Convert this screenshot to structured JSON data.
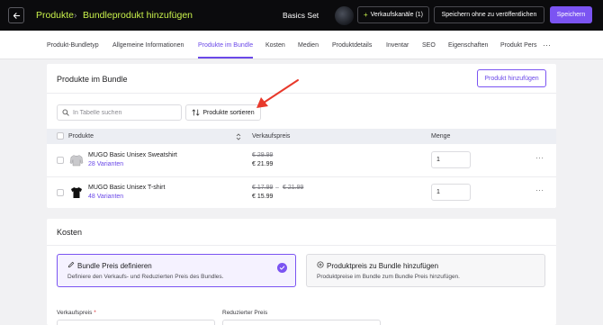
{
  "header": {
    "breadcrumb_root": "Produkte",
    "breadcrumb_current": "Bundleprodukt hinzufügen",
    "product_title": "Basics Set",
    "channels_button": "Verkaufskanäle (1)",
    "save_draft_button": "Speichern ohne zu veröffentlichen",
    "save_button": "Speichern"
  },
  "tabs": [
    {
      "label": "Produkt-Bundletyp"
    },
    {
      "label": "Allgemeine Informationen"
    },
    {
      "label": "Produkte im Bundle",
      "active": true
    },
    {
      "label": "Kosten"
    },
    {
      "label": "Medien"
    },
    {
      "label": "Produktdetails"
    },
    {
      "label": "Inventar"
    },
    {
      "label": "SEO"
    },
    {
      "label": "Eigenschaften"
    },
    {
      "label": "Produkt Pers"
    }
  ],
  "products_section": {
    "title": "Produkte im Bundle",
    "add_button": "Produkt hinzufügen",
    "search_placeholder": "In Tabelle suchen",
    "sort_button": "Produkte sortieren",
    "columns": {
      "product": "Produkte",
      "price": "Verkaufspreis",
      "quantity": "Menge"
    },
    "rows": [
      {
        "name": "MUGO Basic Unisex Sweatshirt",
        "variants": "28 Varianten",
        "old_price": "€ 29.99",
        "old_price_max": "",
        "price": "€ 21.99",
        "quantity": "1",
        "icon": "sweatshirt-icon"
      },
      {
        "name": "MUGO Basic Unisex T-shirt",
        "variants": "48 Varianten",
        "old_price": "€ 17.99",
        "old_price_max": "€ 21.99",
        "price": "€ 15.99",
        "quantity": "1",
        "icon": "tshirt-icon"
      }
    ]
  },
  "costs_section": {
    "title": "Kosten",
    "option_define": {
      "title": "Bundle Preis definieren",
      "description": "Definiere den Verkaufs- und Reduzierten Preis des Bundles."
    },
    "option_add": {
      "title": "Produktpreis zu Bundle hinzufügen",
      "description": "Produktpreise im Bundle zum Bundle Preis hinzufügen."
    },
    "sale_price_label": "Verkaufspreis",
    "required_mark": "*",
    "reduced_price_label": "Reduzierter Preis"
  },
  "colors": {
    "accent": "#7b54f2",
    "brand_lime": "#c8f04b",
    "annotation_arrow": "#e8392b"
  }
}
